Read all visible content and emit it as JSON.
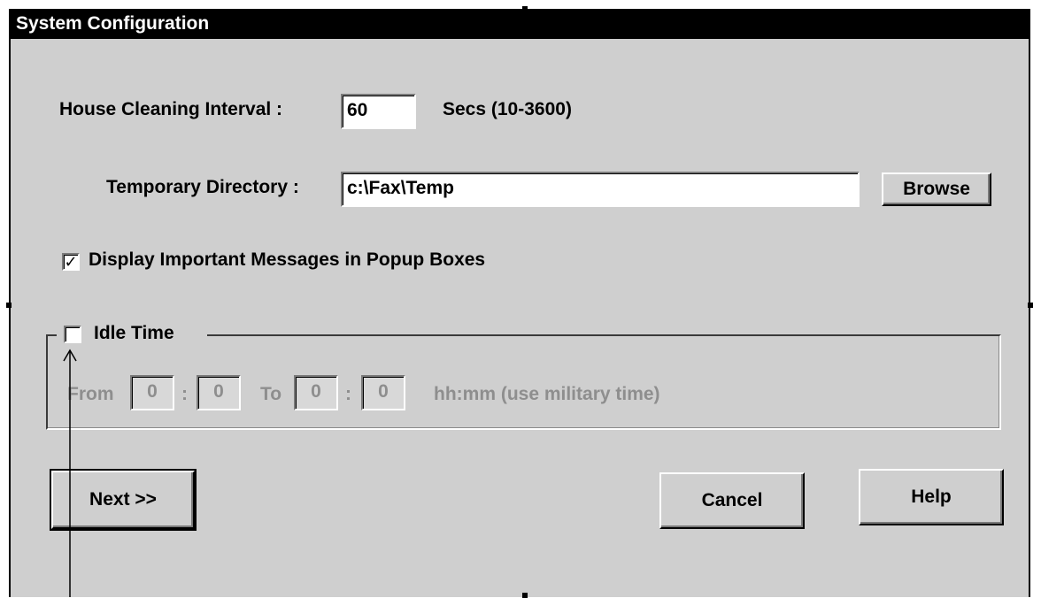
{
  "window": {
    "title": "System Configuration"
  },
  "house_cleaning": {
    "label": "House Cleaning Interval :",
    "value": "60",
    "unit_label": "Secs (10-3600)"
  },
  "temp_dir": {
    "label": "Temporary Directory :",
    "value": "c:\\Fax\\Temp",
    "browse_label": "Browse"
  },
  "popup_option": {
    "label": "Display Important Messages in Popup Boxes",
    "checked": true,
    "check_glyph": "✓"
  },
  "idle_time": {
    "label": "Idle Time",
    "checked": false,
    "from_label": "From",
    "from_hour": "0",
    "from_minute": "0",
    "colon": ":",
    "to_label": "To",
    "to_hour": "0",
    "to_minute": "0",
    "format_hint": "hh:mm (use military time)"
  },
  "buttons": {
    "next_label": "Next >>",
    "cancel_label": "Cancel",
    "help_label": "Help"
  },
  "icons": {
    "pointer": "arrow-up-icon"
  },
  "colors": {
    "titlebar": "#000000",
    "dialog_bg": "#cfcfcf",
    "disabled_text": "#8e8e8e"
  }
}
